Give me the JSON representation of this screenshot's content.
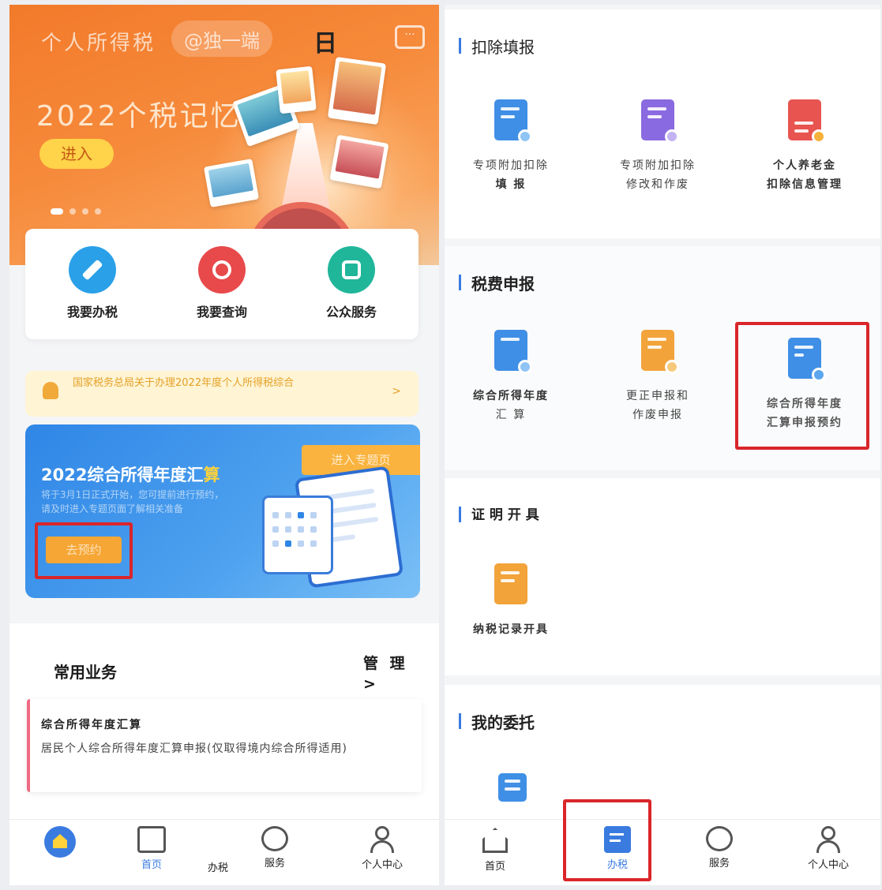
{
  "left": {
    "banner": {
      "title": "个人所得税",
      "handle": "@独一端",
      "day": "日",
      "headline": "2022个税记忆",
      "enter": "进入"
    },
    "quick": [
      {
        "label": "我要办税",
        "icon": "pen-icon",
        "color": "#2aa0e8"
      },
      {
        "label": "我要查询",
        "icon": "search-icon",
        "color": "#e8494b"
      },
      {
        "label": "公众服务",
        "icon": "public-service-icon",
        "color": "#20b69a"
      }
    ],
    "notice": {
      "text": "国家税务总局关于办理2022年度个人所得税综合",
      "arrow": ">"
    },
    "promo": {
      "title": "2022综合所得年度汇",
      "title_highlight": "算",
      "subtitle": "将于3月1日正式开始，您可提前进行预约，请及时进入专题页面了解相关准备",
      "tag": "进入专题页",
      "button": "去预约"
    },
    "common": {
      "header": "常用业务",
      "manage": "管 理",
      "manage_arrow": ">",
      "card_title": "综合所得年度汇算",
      "card_desc": "居民个人综合所得年度汇算申报(仅取得境内综合所得适用)",
      "card_arrow": ">"
    },
    "tabs": [
      {
        "label": "首页",
        "icon": "home-icon",
        "active": true
      },
      {
        "label": "办税",
        "icon": "tax-doc-icon",
        "active": false
      },
      {
        "label": "服务",
        "icon": "heart-service-icon",
        "active": false
      },
      {
        "label": "个人中心",
        "icon": "user-icon",
        "active": false
      }
    ]
  },
  "right": {
    "deduction": {
      "header": "扣除填报",
      "items": [
        {
          "line1": "专项附加扣除",
          "line2": "填 报",
          "icon": "special-deduction-fill-icon",
          "color": "#3f8fe6"
        },
        {
          "line1": "专项附加扣除",
          "line2": "修改和作废",
          "icon": "special-deduction-edit-icon",
          "color": "#8a6ae0"
        },
        {
          "line1": "个人养老金",
          "line2": "扣除信息管理",
          "icon": "pension-icon",
          "color": "#e8544f"
        }
      ]
    },
    "declare": {
      "header": "税费申报",
      "items": [
        {
          "line1": "综合所得年度",
          "line2": "汇 算",
          "icon": "annual-settlement-icon",
          "color": "#3f8fe6"
        },
        {
          "line1": "更正申报和",
          "line2": "作废申报",
          "icon": "correction-icon",
          "color": "#f2a33a"
        },
        {
          "line1": "综合所得年度",
          "line2": "汇算申报预约",
          "icon": "appointment-icon",
          "color": "#3f8fe6"
        }
      ]
    },
    "certificate": {
      "header": "证 明 开 具",
      "items": [
        {
          "line1": "纳税记录开具",
          "icon": "tax-record-icon",
          "color": "#f2a33a"
        }
      ]
    },
    "entrust": {
      "header": "我的委托"
    },
    "tabs": [
      {
        "label": "首页",
        "icon": "home-icon",
        "active": false
      },
      {
        "label": "办税",
        "icon": "tax-doc-icon",
        "active": true
      },
      {
        "label": "服务",
        "icon": "heart-service-icon",
        "active": false
      },
      {
        "label": "个人中心",
        "icon": "user-icon",
        "active": false
      }
    ]
  },
  "colors": {
    "accent": "#3a7be0",
    "highlight_box": "#d9262a",
    "banner": "#f27a2a"
  }
}
